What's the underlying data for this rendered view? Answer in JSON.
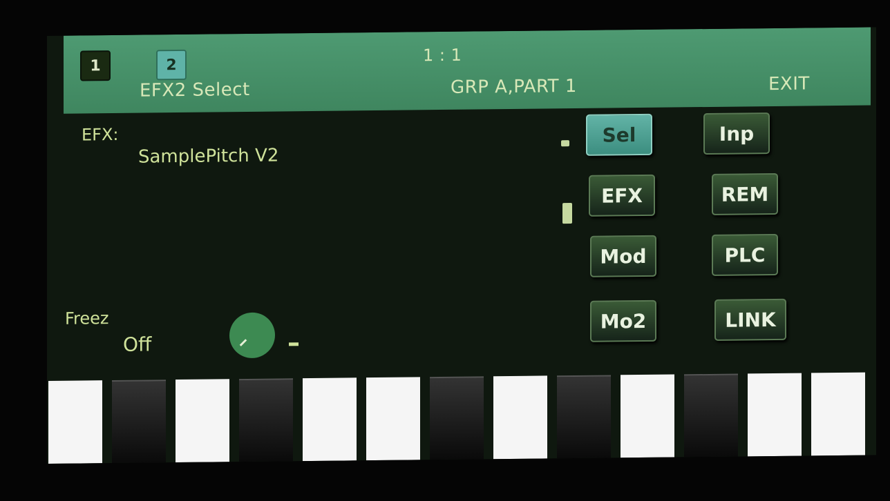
{
  "header": {
    "tabs": [
      "1",
      "2"
    ],
    "title": "EFX2 Select",
    "position": "1 : 1",
    "group": "GRP A,PART 1",
    "exit_label": "EXIT"
  },
  "main": {
    "efx_label": "EFX:",
    "efx_value": "SamplePitch V2",
    "freeze_label": "Freez",
    "freeze_value": "Off"
  },
  "buttons": {
    "sel": "Sel",
    "inp": "Inp",
    "efx": "EFX",
    "rem": "REM",
    "mod": "Mod",
    "plc": "PLC",
    "mo2": "Mo2",
    "link": "LINK"
  },
  "keyboard": {
    "keys": [
      "white",
      "black",
      "white",
      "black",
      "white",
      "white",
      "black",
      "white",
      "black",
      "white",
      "black",
      "white",
      "white"
    ]
  },
  "colors": {
    "header_bg": "#4e9a72",
    "screen_bg": "#0f180f",
    "text": "#cfe29a",
    "selected_button": "#62b3a6"
  }
}
